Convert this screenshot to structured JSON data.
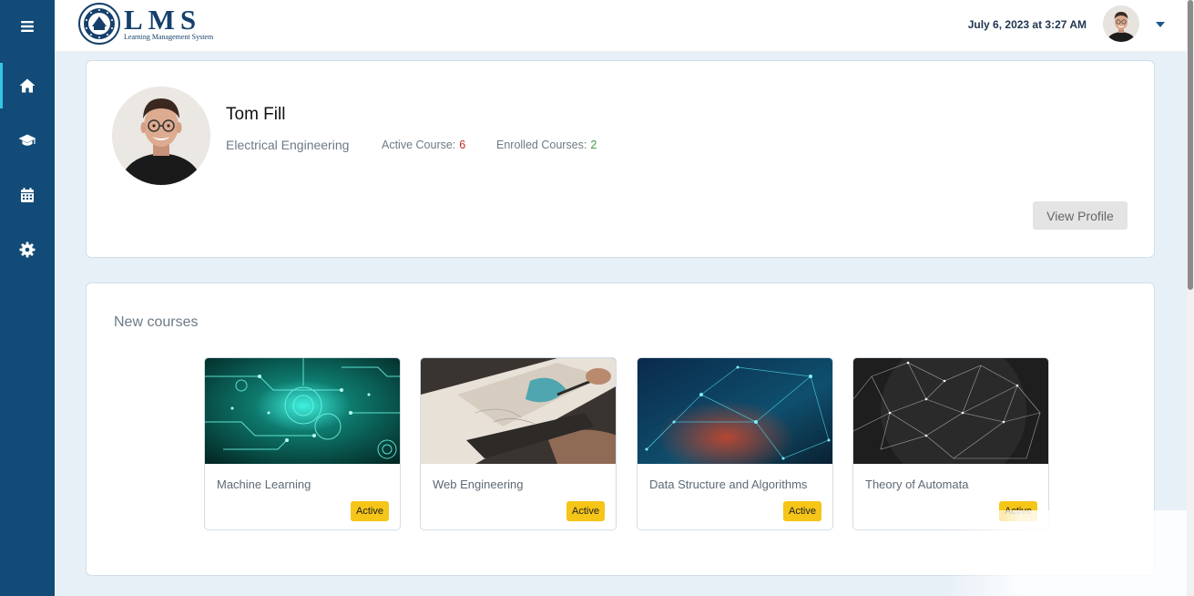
{
  "header": {
    "logo_title": "LMS",
    "logo_subtitle": "Learning Management System",
    "datetime": "July 6, 2023 at 3:27 AM"
  },
  "sidebar": {
    "items": [
      {
        "icon": "menu-icon"
      },
      {
        "icon": "home-icon",
        "active": true
      },
      {
        "icon": "graduation-cap-icon"
      },
      {
        "icon": "calendar-icon"
      },
      {
        "icon": "gear-icon"
      }
    ]
  },
  "profile": {
    "name": "Tom Fill",
    "department": "Electrical Engineering",
    "active_course_label": "Active Course:",
    "active_course_count": "6",
    "enrolled_courses_label": "Enrolled Courses:",
    "enrolled_courses_count": "2",
    "view_profile_label": "View Profile"
  },
  "courses_section": {
    "title": "New courses",
    "courses": [
      {
        "title": "Machine Learning",
        "status": "Active"
      },
      {
        "title": "Web Engineering",
        "status": "Active"
      },
      {
        "title": "Data Structure and Algorithms",
        "status": "Active"
      },
      {
        "title": "Theory of Automata",
        "status": "Active"
      }
    ]
  },
  "colors": {
    "sidebar_bg": "#124b77",
    "active_indicator": "#35c6e6",
    "badge_bg": "#f5c518",
    "active_course_num": "#c62828",
    "enrolled_num": "#3c9d47"
  }
}
